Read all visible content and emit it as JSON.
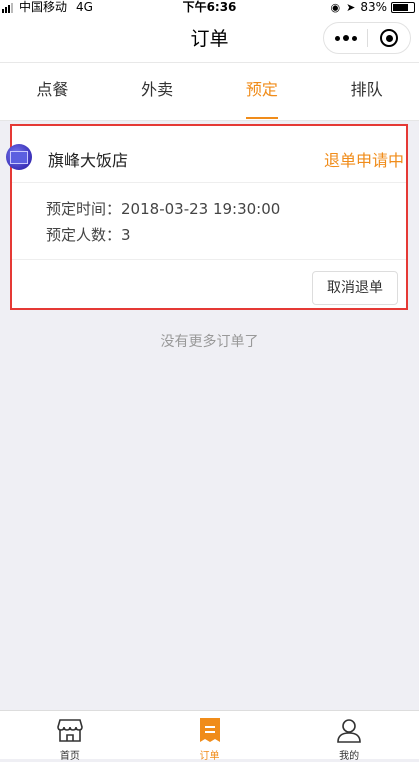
{
  "status_bar": {
    "carrier": "中国移动",
    "network": "4G",
    "time": "下午6:36",
    "battery": "83%",
    "battery_level": 0.83
  },
  "nav": {
    "title": "订单"
  },
  "tabs": [
    {
      "label": "点餐",
      "active": false
    },
    {
      "label": "外卖",
      "active": false
    },
    {
      "label": "预定",
      "active": true
    },
    {
      "label": "排队",
      "active": false
    }
  ],
  "order": {
    "store_name": "旗峰大饭店",
    "status": "退单申请中",
    "reserve_time_label": "预定时间：",
    "reserve_time": "2018-03-23 19:30:00",
    "people_label": "预定人数：",
    "people": "3",
    "cancel_refund_label": "取消退单"
  },
  "no_more_text": "没有更多订单了",
  "tabbar": [
    {
      "label": "首页",
      "icon": "store-icon"
    },
    {
      "label": "订单",
      "icon": "order-list-icon",
      "active": true
    },
    {
      "label": "我的",
      "icon": "user-icon"
    }
  ],
  "colors": {
    "accent": "#f08c1a",
    "highlight_border": "#e53935"
  }
}
